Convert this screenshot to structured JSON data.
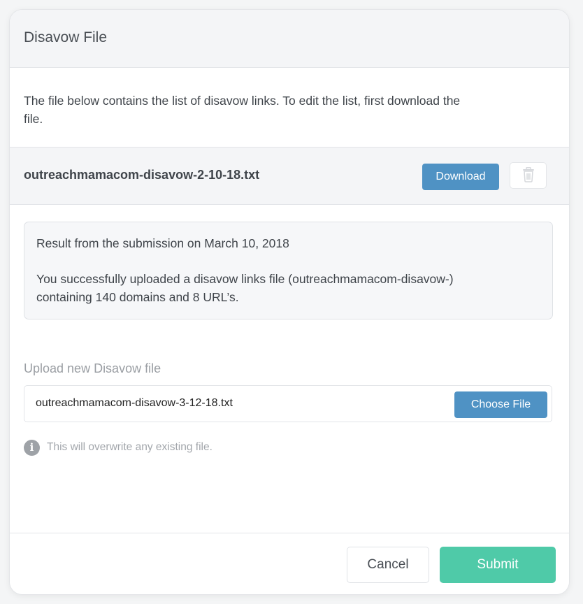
{
  "modal": {
    "title": "Disavow File",
    "intro": "The file below contains the list of disavow links. To edit the list, first download the file."
  },
  "current_file": {
    "name": "outreachmamacom-disavow-2-10-18.txt",
    "download_label": "Download",
    "delete_icon": "trash-icon"
  },
  "result": {
    "title": "Result from the submission on March 10, 2018",
    "message": "You successfully uploaded a disavow links file (outreachmamacom-disavow-) containing 140 domains and 8 URL’s."
  },
  "upload": {
    "label": "Upload new Disavow file",
    "value": "outreachmamacom-disavow-3-12-18.txt",
    "choose_label": "Choose File",
    "info_icon": "info-icon",
    "info_glyph": "i",
    "info_text": "This will overwrite any existing file."
  },
  "footer": {
    "cancel_label": "Cancel",
    "submit_label": "Submit"
  },
  "colors": {
    "primary_button": "#4f92c4",
    "submit_button": "#4fcaa8",
    "header_bg": "#f4f5f7"
  }
}
